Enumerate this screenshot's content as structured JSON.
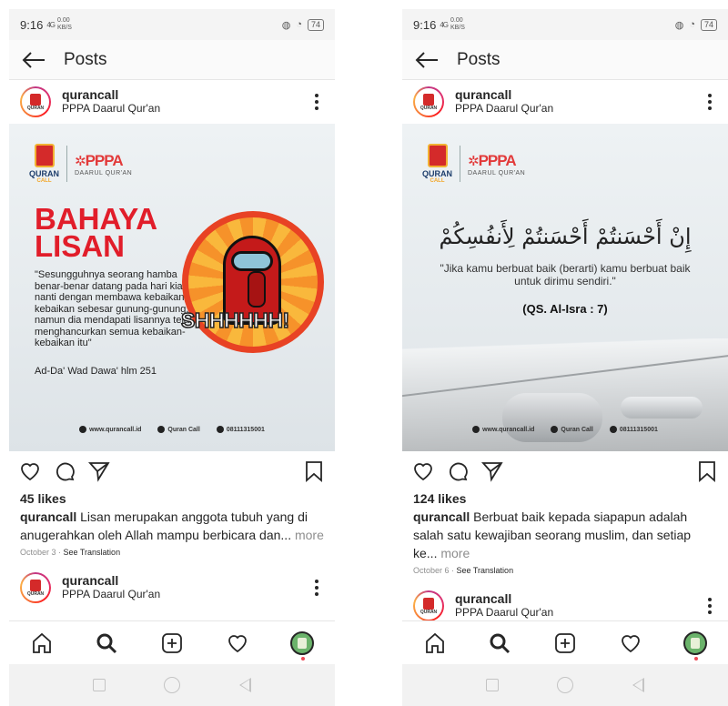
{
  "status": {
    "time": "9:16",
    "signal": "4G",
    "speed_value": "0.00",
    "speed_unit": "KB/S",
    "battery": "74"
  },
  "topbar": {
    "title": "Posts"
  },
  "left": {
    "post": {
      "username": "qurancall",
      "location": "PPPA Daarul Qur'an",
      "image": {
        "brand_qc": "QURAN",
        "brand_qc_sub": "CALL",
        "brand_pppa": "PPPA",
        "brand_pppa_sub": "DAARUL QUR'AN",
        "headline_1": "BAHAYA",
        "headline_2": "LISAN",
        "quote": "\"Sesungguhnya seorang hamba benar-benar datang pada hari kiamat nanti dengan membawa kebaikan-kebaikan sebesar gunung-gunung, namun dia mendapati lisannya telah menghancurkan semua kebaikan-kebaikan itu\"",
        "source": "Ad-Da' Wad Dawa' hlm 251",
        "badge_text": "SHHHHHH!",
        "footer_web": "www.qurancall.id",
        "footer_social": "Quran Call",
        "footer_phone": "08111315001"
      },
      "likes": "45 likes",
      "caption_user": "qurancall",
      "caption_text": " Lisan merupakan anggota tubuh yang di anugerahkan oleh Allah mampu berbicara dan...",
      "more": " more",
      "date": "October 3",
      "see_translation": "See Translation"
    },
    "next_post": {
      "username": "qurancall",
      "location": "PPPA Daarul Qur'an"
    }
  },
  "right": {
    "post": {
      "username": "qurancall",
      "location": "PPPA Daarul Qur'an",
      "image": {
        "brand_qc": "QURAN",
        "brand_qc_sub": "CALL",
        "brand_pppa": "PPPA",
        "brand_pppa_sub": "DAARUL QUR'AN",
        "arabic": "إِنْ أَحْسَنتُمْ أَحْسَنتُمْ لِأَنفُسِكُمْ",
        "quote": "\"Jika kamu berbuat baik (berarti) kamu berbuat baik untuk dirimu sendiri.\"",
        "source": "(QS. Al-Isra : 7)",
        "footer_web": "www.qurancall.id",
        "footer_social": "Quran Call",
        "footer_phone": "08111315001"
      },
      "likes": "124 likes",
      "caption_user": "qurancall",
      "caption_text": " Berbuat baik kepada siapapun adalah salah satu kewajiban seorang muslim, dan setiap ke...",
      "more": " more",
      "date": "October 6",
      "see_translation": "See Translation"
    },
    "next_post": {
      "username": "qurancall",
      "location": "PPPA Daarul Qur'an"
    }
  },
  "colors": {
    "accent_red": "#e11d2a",
    "text": "#262626",
    "muted": "#8e8e8e",
    "notif_dot": "#ed4956"
  },
  "icons": [
    "back-arrow-icon",
    "more-dots-icon",
    "heart-icon",
    "comment-icon",
    "share-icon",
    "bookmark-icon",
    "home-icon",
    "search-icon",
    "new-post-icon",
    "activity-icon",
    "profile-avatar",
    "recent-apps-icon",
    "home-circle-icon",
    "back-triangle-icon"
  ]
}
